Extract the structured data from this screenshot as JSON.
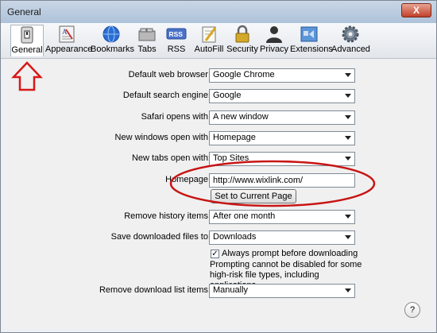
{
  "window": {
    "title": "General",
    "close_symbol": "X"
  },
  "toolbar": {
    "items": [
      {
        "label": "General",
        "icon": "general-switch-icon",
        "selected": true
      },
      {
        "label": "Appearance",
        "icon": "appearance-icon"
      },
      {
        "label": "Bookmarks",
        "icon": "globe-icon"
      },
      {
        "label": "Tabs",
        "icon": "tabs-icon"
      },
      {
        "label": "RSS",
        "icon": "rss-icon"
      },
      {
        "label": "AutoFill",
        "icon": "pencil-icon"
      },
      {
        "label": "Security",
        "icon": "lock-icon"
      },
      {
        "label": "Privacy",
        "icon": "person-icon"
      },
      {
        "label": "Extensions",
        "icon": "puzzle-icon"
      },
      {
        "label": "Advanced",
        "icon": "gear-icon"
      }
    ]
  },
  "settings": {
    "default_browser": {
      "label": "Default web browser:",
      "value": "Google Chrome"
    },
    "search_engine": {
      "label": "Default search engine:",
      "value": "Google"
    },
    "safari_opens": {
      "label": "Safari opens with:",
      "value": "A new window"
    },
    "new_windows": {
      "label": "New windows open with:",
      "value": "Homepage"
    },
    "new_tabs": {
      "label": "New tabs open with:",
      "value": "Top Sites"
    },
    "homepage": {
      "label": "Homepage:",
      "value": "http://www.wixlink.com/"
    },
    "set_current": {
      "label": "Set to Current Page"
    },
    "history": {
      "label": "Remove history items:",
      "value": "After one month"
    },
    "downloads": {
      "label": "Save downloaded files to:",
      "value": "Downloads"
    },
    "prompt_checkbox": {
      "label": "Always prompt before downloading",
      "checked": true
    },
    "prompt_note": "Prompting cannot be disabled for some high-risk file types, including applications.",
    "download_list": {
      "label": "Remove download list items:",
      "value": "Manually"
    }
  },
  "help": {
    "symbol": "?"
  },
  "annotation_colors": {
    "arrow": "#d81818",
    "ellipse": "#c81414"
  }
}
